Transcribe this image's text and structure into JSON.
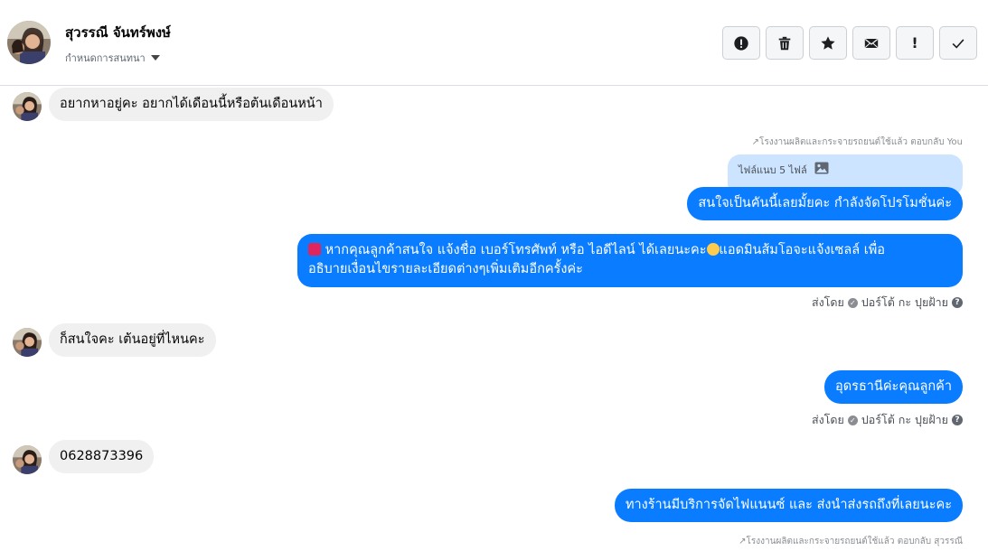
{
  "header": {
    "contact_name": "สุวรรณี จันทร์พงษ์",
    "conversation_menu_label": "กำหนดการสนทนา",
    "actions": [
      "report",
      "delete",
      "star",
      "mail",
      "important",
      "done"
    ]
  },
  "messages": {
    "m1": "อยากหาอยู่คะ อยากได้เดือนนี้หรือต้นเดือนหน้า",
    "reply_note_1": "↗โรงงานผลิตและกระจายรถยนต์ใช้แล้ว ตอบกลับ You",
    "attachment_label": "ไฟล์แนบ 5 ไฟล์",
    "m2": "สนใจเป็นคันนี้เลยมั้ยคะ กำลังจัดโปรโมชั่นค่ะ",
    "m3_line1": "หากคุณลูกค้าสนใจ แจ้งชื่อ เบอร์โทรศัพท์ หรือ ไอดีไลน์  ได้เลยนะคะ",
    "m3_line1b": "แอดมินส้มโอจะแจ้งเซลล์   เพื่อ",
    "m3_line2": "อธิบายเงื่อนไขรายละเอียดต่างๆเพิ่มเติมอีกครั้งค่ะ",
    "sent_by_1": "ส่งโดย",
    "sender_1": "ปอร์โต้ กะ ปุยฝ้าย",
    "m4": "ก็สนใจคะ  เต้นอยู่ที่ไหนคะ",
    "m5": "อุดรธานีค่ะคุณลูกค้า",
    "sent_by_2": "ส่งโดย",
    "sender_2": "ปอร์โต้ กะ ปุยฝ้าย",
    "m6": "0628873396",
    "m7": "ทางร้านมีบริการจัดไฟแนนซ์ และ ส่งนำส่งรถถึงที่เลยนะคะ",
    "reply_note_2": "↗โรงงานผลิตและกระจายรถยนต์ใช้แล้ว ตอบกลับ สุวรรณี"
  },
  "colors": {
    "outgoing": "#0a7cff",
    "incoming": "#f0f0f0",
    "attachment": "#cce4ff"
  }
}
